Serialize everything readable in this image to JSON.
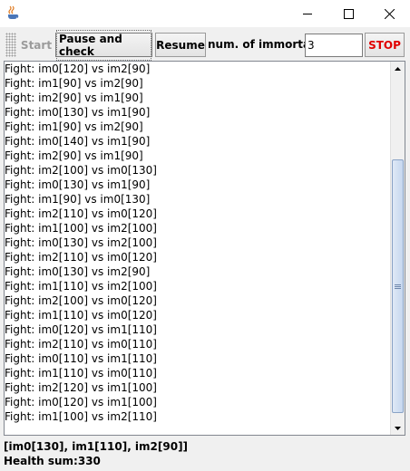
{
  "icons": {
    "app": "java-cup-icon",
    "minimize": "minimize-icon",
    "maximize": "maximize-icon",
    "close": "close-icon",
    "scroll_up": "arrow-up-icon",
    "scroll_down": "arrow-down-icon"
  },
  "colors": {
    "stop": "#e00000",
    "disabled_text": "#9b9b9b"
  },
  "toolbar": {
    "start_label": "Start",
    "pause_label": "Pause and check",
    "resume_label": "Resume",
    "immortals_label": "num. of immortals:",
    "immortals_value": "3",
    "stop_label": "STOP"
  },
  "log": [
    "Fight: im0[120] vs im2[90]",
    "Fight: im1[90] vs im2[90]",
    "Fight: im2[90] vs im1[90]",
    "Fight: im0[130] vs im1[90]",
    "Fight: im1[90] vs im2[90]",
    "Fight: im0[140] vs im1[90]",
    "Fight: im2[90] vs im1[90]",
    "Fight: im2[100] vs im0[130]",
    "Fight: im0[130] vs im1[90]",
    "Fight: im1[90] vs im0[130]",
    "Fight: im2[110] vs im0[120]",
    "Fight: im1[100] vs im2[100]",
    "Fight: im0[130] vs im2[100]",
    "Fight: im2[110] vs im0[120]",
    "Fight: im0[130] vs im2[90]",
    "Fight: im1[110] vs im2[100]",
    "Fight: im2[100] vs im0[120]",
    "Fight: im1[110] vs im0[120]",
    "Fight: im0[120] vs im1[110]",
    "Fight: im2[110] vs im0[110]",
    "Fight: im0[110] vs im1[110]",
    "Fight: im1[110] vs im0[110]",
    "Fight: im2[120] vs im1[100]",
    "Fight: im0[120] vs im1[100]",
    "Fight: im1[100] vs im2[110]"
  ],
  "status": {
    "immortals": "[im0[130], im1[110], im2[90]]",
    "health_sum": "Health sum:330"
  }
}
